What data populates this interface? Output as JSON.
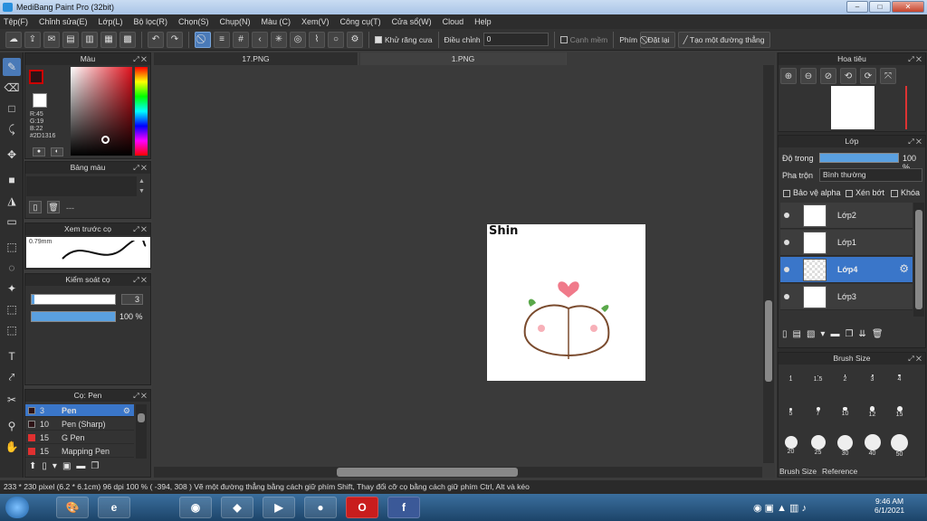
{
  "window": {
    "title": "MediBang Paint Pro (32bit)"
  },
  "menu": [
    "Tệp(F)",
    "Chỉnh sửa(E)",
    "Lớp(L)",
    "Bộ lọc(R)",
    "Chọn(S)",
    "Chụp(N)",
    "Màu (C)",
    "Xem(V)",
    "Công cụ(T)",
    "Cửa sổ(W)",
    "Cloud",
    "Help"
  ],
  "toolbar": {
    "antialias_label": "Khử răng cưa",
    "adjust_label": "Điều chỉnh",
    "adjust_value": "0",
    "snap_edge_label": "Cạnh mềm",
    "key_label": "Phím",
    "reset_label": "Đặt lại",
    "create_line_label": "Tạo một đường thẳng"
  },
  "color_panel": {
    "title": "Màu",
    "r": "R:45",
    "g": "G:19",
    "b": "B:22",
    "hex": "#2D1316",
    "fg": "#2D1316"
  },
  "palette_panel": {
    "title": "Bảng màu",
    "footer": "---"
  },
  "brush_preview": {
    "title": "Xem trước cọ",
    "size": "0.79mm"
  },
  "brush_control": {
    "title": "Kiểm soát cọ",
    "size_value": "3",
    "opacity_value": "100 %"
  },
  "brush_panel": {
    "title": "Cọ: Pen",
    "items": [
      {
        "num": "3",
        "name": "Pen",
        "color": "#2D1316"
      },
      {
        "num": "10",
        "name": "Pen (Sharp)",
        "color": "#2D1316"
      },
      {
        "num": "15",
        "name": "G Pen",
        "color": "#e03030"
      },
      {
        "num": "15",
        "name": "Mapping Pen",
        "color": "#e03030"
      }
    ]
  },
  "tabs": [
    "17.PNG",
    "1.PNG"
  ],
  "canvas": {
    "text": "Shin"
  },
  "navigator": {
    "title": "Hoa tiêu"
  },
  "layer_panel": {
    "title": "Lớp",
    "opacity_label": "Độ trong",
    "opacity_value": "100 %",
    "blend_label": "Pha trộn",
    "blend_value": "Bình thường",
    "protect_alpha": "Bảo vệ alpha",
    "clipping": "Xén bớt",
    "lock": "Khóa",
    "layers": [
      {
        "name": "Lớp2"
      },
      {
        "name": "Lớp1"
      },
      {
        "name": "Lớp4"
      },
      {
        "name": "Lớp3"
      }
    ]
  },
  "brush_size_panel": {
    "title": "Brush Size",
    "sizes": [
      "1",
      "1.5",
      "2",
      "3",
      "4",
      "5",
      "7",
      "10",
      "12",
      "15",
      "20",
      "25",
      "30",
      "40",
      "50"
    ],
    "tab1": "Brush Size",
    "tab2": "Reference"
  },
  "status": "233 * 230 pixel   (6.2 * 6.1cm)   96 dpi   100 %   ( -394, 308 )   Vẽ một đường thẳng bằng cách giữ phím Shift, Thay đổi cỡ cọ bằng cách giữ phím Ctrl, Alt và kéo",
  "taskbar": {
    "time": "9:46 AM",
    "date": "6/1/2021"
  }
}
